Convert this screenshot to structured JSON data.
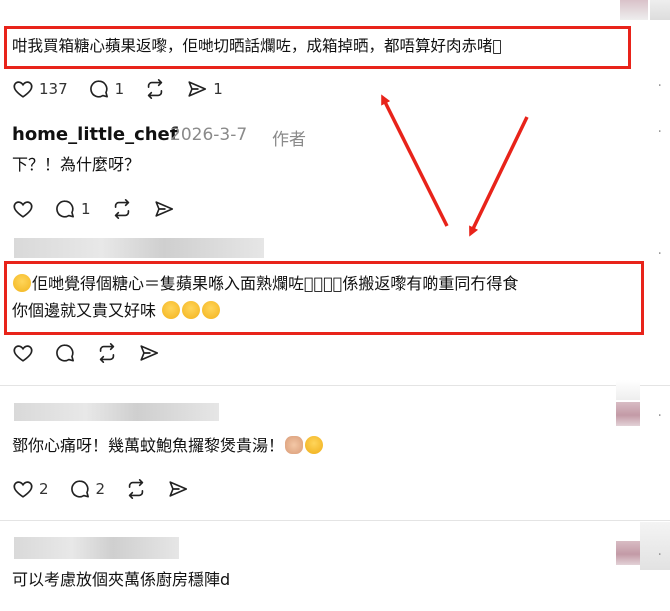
{
  "comments": [
    {
      "text": "咁我買箱糖心蘋果返嚟，佢哋切晒話爛咗，成箱掉晒，都唔算好肉赤啫􀀀",
      "likes": "137",
      "replies": "1",
      "shares": "1"
    },
    {
      "author": "home_little_chef",
      "date": "2026-3-7",
      "role": "作者",
      "text": "下？！為什麼呀？",
      "replies": "1"
    },
    {
      "text_line1": "佢哋覺得個糖心＝隻蘋果喺入面熟爛咗􀀀􀀀􀀀，係搬返嚟有啲重同冇得食",
      "text_line2_a": "你個邊就又貴又好味",
      "emojis": [
        "sad-face-emoji",
        "yum-face-emoji",
        "yum-face-emoji",
        "yum-face-emoji"
      ]
    },
    {
      "text": "鄧你心痛呀！幾萬蚊鮑魚攞黎煲貴湯！",
      "likes": "2",
      "replies": "2",
      "emojis": [
        "pray-hands-emoji",
        "sweat-smile-emoji"
      ]
    },
    {
      "text": "可以考慮放個夾萬係廚房穩陣d"
    }
  ],
  "more_glyph": "·",
  "colors": {
    "highlight": "#e8231a",
    "text": "#111111",
    "muted": "#8a8a8a"
  }
}
